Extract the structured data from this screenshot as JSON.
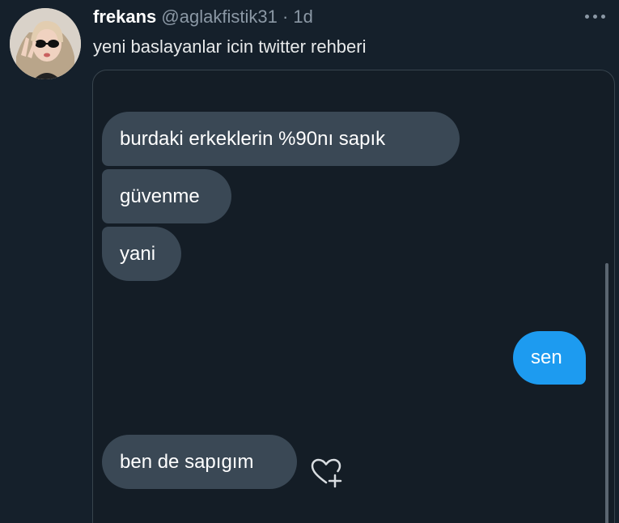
{
  "tweet": {
    "display_name": "frekans",
    "handle": "@aglakfistik31",
    "separator": "·",
    "age": "1d",
    "text": "yeni baslayanlar icin twitter rehberi"
  },
  "chat": {
    "messages": [
      {
        "side": "received",
        "text": "burdaki erkeklerin %90nı sapık"
      },
      {
        "side": "received",
        "text": "güvenme"
      },
      {
        "side": "received",
        "text": "yani"
      },
      {
        "side": "sent",
        "text": "sen"
      },
      {
        "side": "received",
        "text": "ben de sapıgım"
      }
    ]
  },
  "icons": {
    "more": "more-horizontal-icon",
    "react": "heart-plus-icon"
  },
  "colors": {
    "background": "#15202b",
    "received_bubble": "#3a4855",
    "sent_bubble": "#1d9bf0",
    "muted_text": "#8b98a5"
  }
}
